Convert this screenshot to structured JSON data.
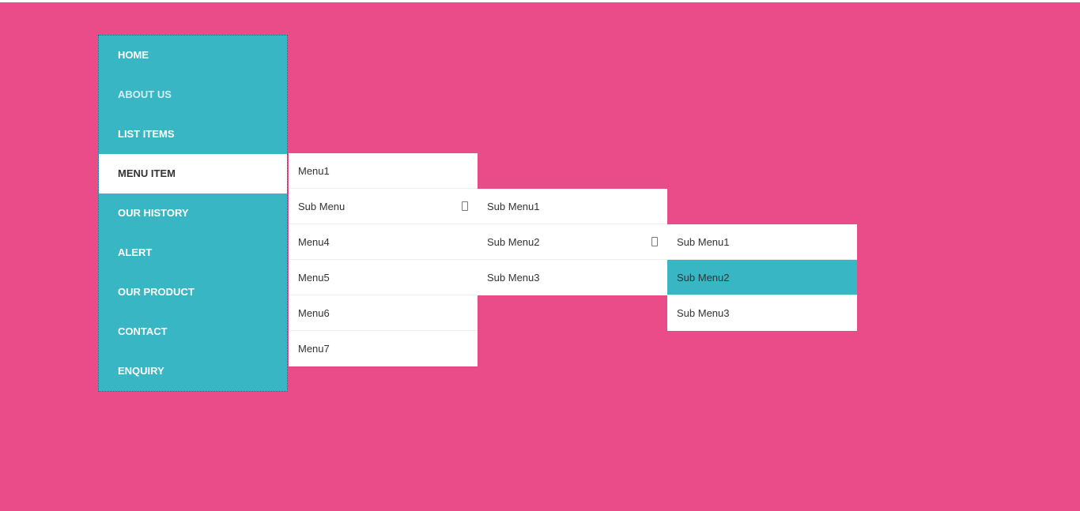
{
  "sidebar": {
    "items": [
      {
        "label": "HOME",
        "dim": false,
        "active": false
      },
      {
        "label": "ABOUT US",
        "dim": true,
        "active": false
      },
      {
        "label": "LIST ITEMS",
        "dim": false,
        "active": false
      },
      {
        "label": "MENU ITEM",
        "dim": false,
        "active": true
      },
      {
        "label": "OUR HISTORY",
        "dim": false,
        "active": false
      },
      {
        "label": "ALERT",
        "dim": false,
        "active": false
      },
      {
        "label": "OUR PRODUCT",
        "dim": false,
        "active": false
      },
      {
        "label": "CONTACT",
        "dim": false,
        "active": false
      },
      {
        "label": "ENQUIRY",
        "dim": false,
        "active": false
      }
    ]
  },
  "flyout1": [
    {
      "label": "Menu1",
      "arrow": false
    },
    {
      "label": "Sub Menu",
      "arrow": true
    },
    {
      "label": "Menu4",
      "arrow": false
    },
    {
      "label": "Menu5",
      "arrow": false
    },
    {
      "label": "Menu6",
      "arrow": false
    },
    {
      "label": "Menu7",
      "arrow": false
    }
  ],
  "flyout2": [
    {
      "label": "Sub Menu1",
      "arrow": false
    },
    {
      "label": "Sub Menu2",
      "arrow": true
    },
    {
      "label": "Sub Menu3",
      "arrow": false
    }
  ],
  "flyout3": [
    {
      "label": "Sub Menu1",
      "highlight": false
    },
    {
      "label": "Sub Menu2",
      "highlight": true
    },
    {
      "label": "Sub Menu3",
      "highlight": false
    }
  ]
}
